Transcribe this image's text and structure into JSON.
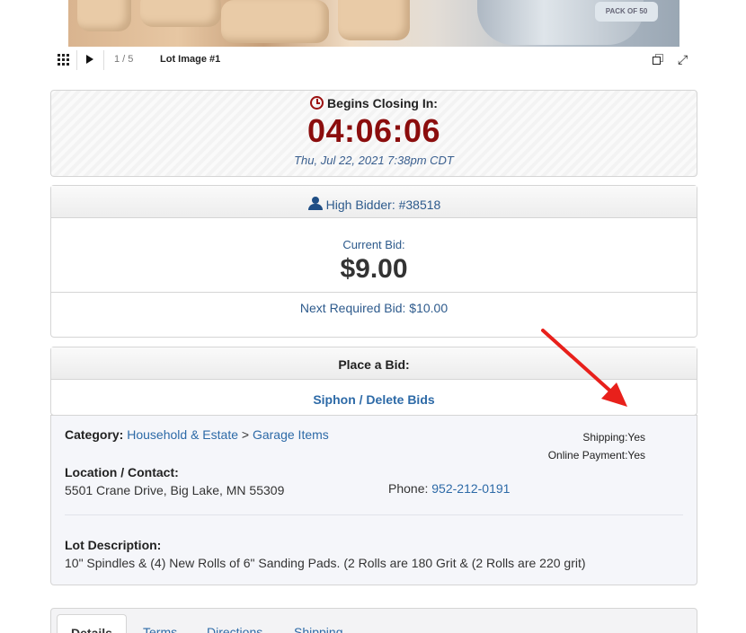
{
  "gallery": {
    "photo_label": "PACK OF 50",
    "counter": "1 / 5",
    "caption": "Lot Image #1"
  },
  "closing": {
    "heading": "Begins Closing In:",
    "timer": "04:06:06",
    "close_date": "Thu, Jul 22, 2021 7:38pm CDT"
  },
  "bid_status": {
    "high_bidder": "High Bidder: #38518",
    "current_bid_label": "Current Bid:",
    "current_bid_amount": "$9.00",
    "next_required": "Next Required Bid: $10.00"
  },
  "place_bid": {
    "heading": "Place a Bid:",
    "siphon_link": "Siphon / Delete Bids"
  },
  "details": {
    "category_label": "Category:",
    "category_primary": "Household & Estate",
    "category_sep": ">",
    "category_secondary": "Garage Items",
    "shipping": "Shipping:Yes",
    "online_payment": "Online Payment:Yes",
    "location_label": "Location / Contact:",
    "address": "5501 Crane Drive, Big Lake, MN 55309",
    "phone_label": "Phone:",
    "phone": "952-212-0191",
    "description_label": "Lot Description:",
    "description": "10\" Spindles & (4) New Rolls of 6\" Sanding Pads. (2 Rolls are 180 Grit & (2 Rolls are 220 grit)"
  },
  "tabs": [
    "Details",
    "Terms",
    "Directions",
    "Shipping"
  ],
  "colors": {
    "timer": "#8b0d0d",
    "link": "#2d6aa7",
    "annotation_arrow": "#e8201b"
  }
}
